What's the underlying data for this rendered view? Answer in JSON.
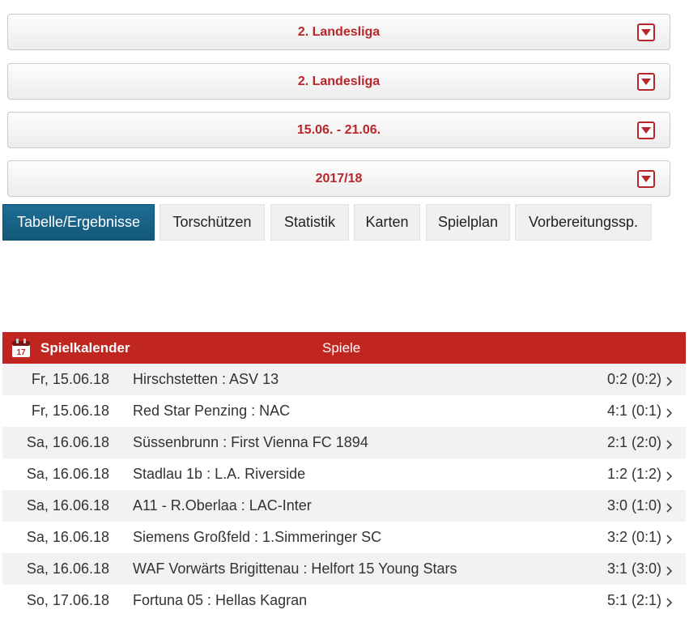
{
  "dropdowns": [
    {
      "label": "2. Landesliga"
    },
    {
      "label": "2. Landesliga"
    },
    {
      "label": "15.06. - 21.06."
    },
    {
      "label": "2017/18"
    }
  ],
  "tabs": [
    {
      "label": "Tabelle/Ergebnisse",
      "active": true
    },
    {
      "label": "Torschützen"
    },
    {
      "label": "Statistik"
    },
    {
      "label": "Karten"
    },
    {
      "label": "Spielplan"
    },
    {
      "label": "Vorbereitungssp."
    }
  ],
  "calendar": {
    "title": "Spielkalender",
    "subtitle": "Spiele",
    "icon_day": "17",
    "icon": "calendar-icon",
    "rows": [
      {
        "date": "Fr, 15.06.18",
        "match": "Hirschstetten : ASV 13",
        "score": "0:2 (0:2)"
      },
      {
        "date": "Fr, 15.06.18",
        "match": "Red Star Penzing : NAC",
        "score": "4:1 (0:1)"
      },
      {
        "date": "Sa, 16.06.18",
        "match": "Süssenbrunn : First Vienna FC 1894",
        "score": "2:1 (2:0)"
      },
      {
        "date": "Sa, 16.06.18",
        "match": "Stadlau 1b : L.A. Riverside",
        "score": "1:2 (1:2)"
      },
      {
        "date": "Sa, 16.06.18",
        "match": "A11 - R.Oberlaa : LAC-Inter",
        "score": "3:0 (1:0)"
      },
      {
        "date": "Sa, 16.06.18",
        "match": "Siemens Großfeld : 1.Simmeringer SC",
        "score": "3:2 (0:1)"
      },
      {
        "date": "Sa, 16.06.18",
        "match": "WAF Vorwärts Brigittenau : Helfort 15 Young Stars",
        "score": "3:1 (3:0)"
      },
      {
        "date": "So, 17.06.18",
        "match": "Fortuna 05 : Hellas Kagran",
        "score": "5:1 (2:1)"
      }
    ]
  },
  "colors": {
    "accent_red": "#c0261f",
    "dropdown_text": "#b8262b",
    "active_tab": "#1a6689"
  }
}
